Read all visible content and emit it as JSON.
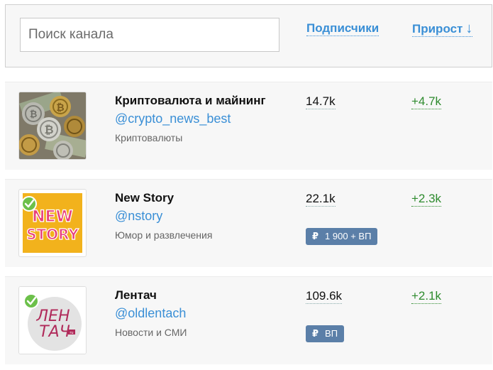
{
  "search": {
    "placeholder": "Поиск канала"
  },
  "columns": {
    "subscribers": "Подписчики",
    "growth": "Прирост",
    "sort_arrow": "↓"
  },
  "channels": [
    {
      "name": "Криптовалюта и майнинг",
      "handle": "@crypto_news_best",
      "category": "Криптовалюты",
      "subscribers": "14.7k",
      "growth": "+4.7k",
      "avatar_icon": "bitcoin-coins-photo"
    },
    {
      "name": "New Story",
      "handle": "@nstory",
      "category": "Юмор и развлечения",
      "subscribers": "22.1k",
      "growth": "+2.3k",
      "price_symbol": "₽",
      "price": "1 900 + ВП",
      "avatar_icon": "new-story-logo",
      "avatar_text": [
        "NEW",
        "STORY"
      ],
      "verified": true
    },
    {
      "name": "Лентач",
      "handle": "@oldlentach",
      "category": "Новости и СМИ",
      "subscribers": "109.6k",
      "growth": "+2.1k",
      "price_symbol": "₽",
      "price": "ВП",
      "avatar_icon": "lentach-logo",
      "avatar_text": [
        "ЛЕН",
        "ТАЧ",
        "ru"
      ],
      "verified": true
    }
  ],
  "colors": {
    "link": "#3a8fd6",
    "growth": "#2e8b2e",
    "badge": "#5b7fa8",
    "verified": "#6cc04a",
    "card_bg": "#f7f7f7"
  }
}
